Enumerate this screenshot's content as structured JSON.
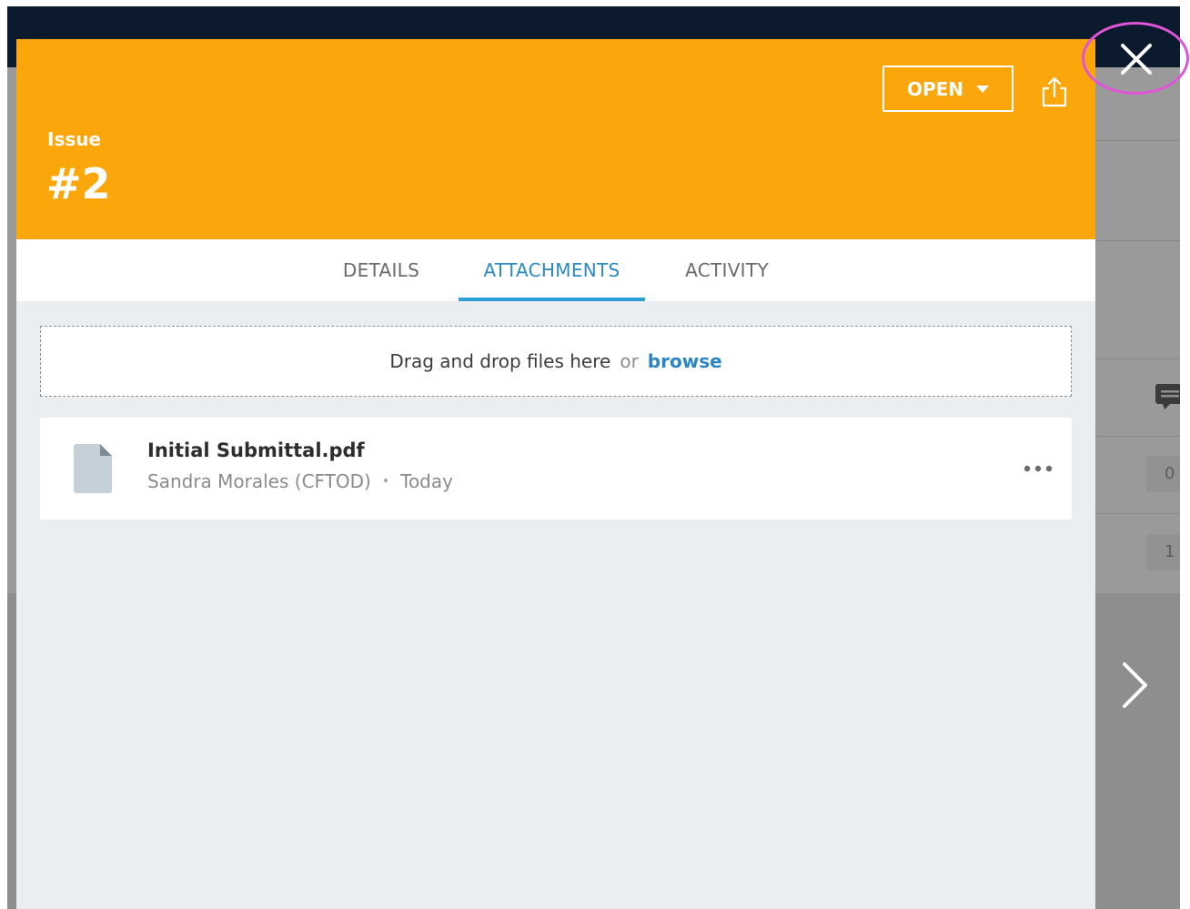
{
  "issue": {
    "label": "Issue",
    "number": "#2",
    "status_label": "OPEN"
  },
  "tabs": [
    {
      "label": "DETAILS",
      "active": false
    },
    {
      "label": "ATTACHMENTS",
      "active": true
    },
    {
      "label": "ACTIVITY",
      "active": false
    }
  ],
  "dropzone": {
    "text": "Drag and drop files here",
    "or_text": "or",
    "browse_label": "browse"
  },
  "attachments": [
    {
      "name": "Initial Submittal.pdf",
      "author": "Sandra Morales (CFTOD)",
      "date": "Today"
    }
  ],
  "background": {
    "counts": [
      "0",
      "1"
    ]
  },
  "icons": {
    "close": "close-icon",
    "share": "share-icon",
    "status_dropdown": "chevron-down-icon",
    "file": "file-icon",
    "more": "more-options-icon",
    "next": "chevron-right-icon",
    "comment": "comment-icon"
  },
  "colors": {
    "header_bg": "#fba70c",
    "accent_blue": "#2aa0d6",
    "panel_bg": "#ebeef0",
    "backdrop": "#8e8e8e",
    "topbar": "#0b1a2c",
    "highlight_ring": "#e054d8"
  }
}
